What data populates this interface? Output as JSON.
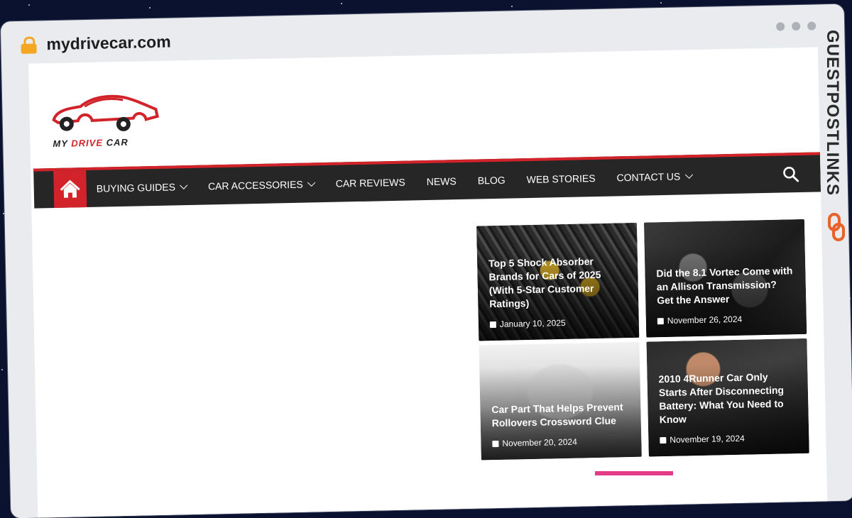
{
  "browser": {
    "url": "mydrivecar.com"
  },
  "brand": {
    "logo_prefix": "MY ",
    "logo_highlight": "DRIVE",
    "logo_suffix": " CAR",
    "accent": "#d3232a"
  },
  "nav": {
    "items": [
      {
        "label": "BUYING GUIDES",
        "dropdown": true
      },
      {
        "label": "CAR ACCESSORIES",
        "dropdown": true
      },
      {
        "label": "CAR REVIEWS",
        "dropdown": false
      },
      {
        "label": "NEWS",
        "dropdown": false
      },
      {
        "label": "BLOG",
        "dropdown": false
      },
      {
        "label": "WEB STORIES",
        "dropdown": false
      },
      {
        "label": "CONTACT US",
        "dropdown": true
      }
    ]
  },
  "posts": [
    {
      "title": "Top 5 Shock Absorber Brands for Cars of 2025 (With 5-Star Customer Ratings)",
      "date": "January 10, 2025"
    },
    {
      "title": "Did the 8.1 Vortec Come with an Allison Transmission? Get the Answer",
      "date": "November 26, 2024"
    },
    {
      "title": "Car Part That Helps Prevent Rollovers Crossword Clue",
      "date": "November 20, 2024"
    },
    {
      "title": "2010 4Runner Car Only Starts After Disconnecting Battery: What You Need to Know",
      "date": "November 19, 2024"
    }
  ],
  "watermark": "GUESTPOSTLINKS"
}
